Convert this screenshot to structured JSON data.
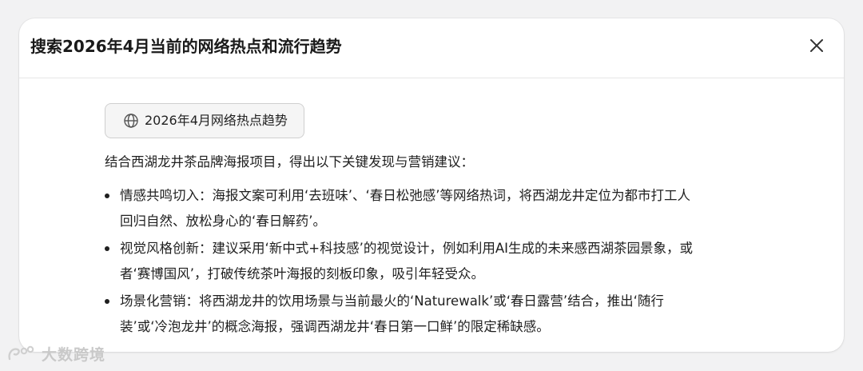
{
  "dialog": {
    "title": "搜索2026年4月当前的网络热点和流行趋势",
    "close_icon": "close-icon"
  },
  "search_chip": {
    "icon": "globe-icon",
    "label": "2026年4月网络热点趋势"
  },
  "intro": "结合西湖龙井茶品牌海报项目，得出以下关键发现与营销建议：",
  "findings": [
    {
      "line1": "情感共鸣切入：海报文案可利用‘去班味’、‘春日松弛感’等网络热词，将西湖龙井定位为都市打工人",
      "line2": "回归自然、放松身心的‘春日解药’。"
    },
    {
      "line1": "视觉风格创新：建议采用‘新中式+科技感’的视觉设计，例如利用AI生成的未来感西湖茶园景象，或",
      "line2": "者‘赛博国风’，打破传统茶叶海报的刻板印象，吸引年轻受众。"
    },
    {
      "line1": "场景化营销：将西湖龙井的饮用场景与当前最火的‘Naturewalk’或‘春日露营’结合，推出‘随行",
      "line2": "装’或‘冷泡龙井’的概念海报，强调西湖龙井‘春日第一口鲜’的限定稀缺感。"
    }
  ],
  "watermark": {
    "text": "大数跨境"
  },
  "colors": {
    "background": "#f2f2f3",
    "dialog": "#ffffff",
    "chip_bg": "#f5f5f5",
    "chip_border": "#cfcfcf",
    "text": "#1f1f1f"
  }
}
